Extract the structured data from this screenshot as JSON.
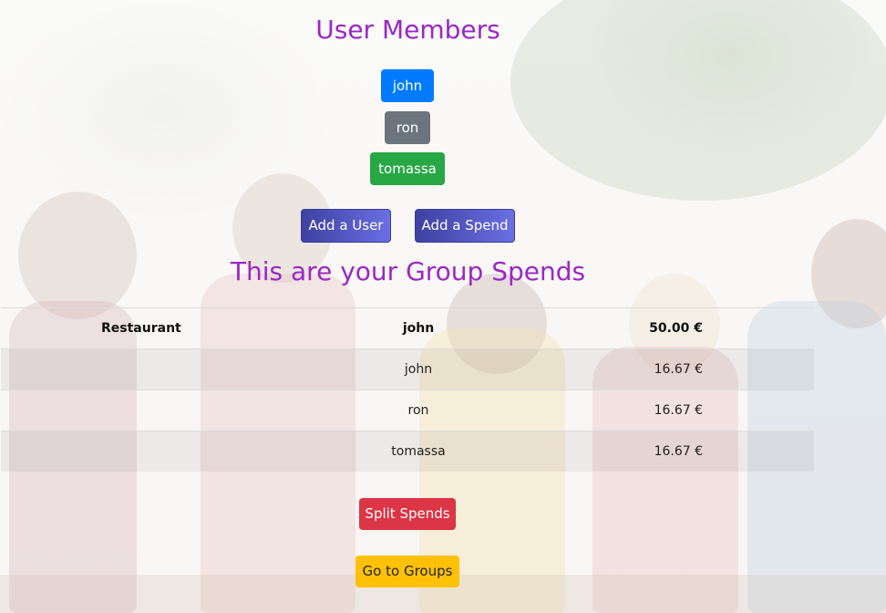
{
  "header": {
    "title": "User Members"
  },
  "members": [
    {
      "name": "john",
      "color": "#007bff"
    },
    {
      "name": "ron",
      "color": "#6c757d"
    },
    {
      "name": "tomassa",
      "color": "#28a745"
    }
  ],
  "actions": {
    "add_user": "Add a User",
    "add_spend": "Add a Spend"
  },
  "spends": {
    "title": "This are your Group Spends",
    "summary": {
      "description": "Restaurant",
      "payer": "john",
      "amount": "50.00 €"
    },
    "shares": [
      {
        "user": "john",
        "amount": "16.67 €"
      },
      {
        "user": "ron",
        "amount": "16.67 €"
      },
      {
        "user": "tomassa",
        "amount": "16.67 €"
      }
    ]
  },
  "footer": {
    "split": "Split Spends",
    "groups": "Go to Groups"
  },
  "colors": {
    "heading": "#9b27c7",
    "split": "#dc3545",
    "groups": "#ffc107",
    "gradient_start": "#3d41a0",
    "gradient_end": "#6a6fe3"
  }
}
